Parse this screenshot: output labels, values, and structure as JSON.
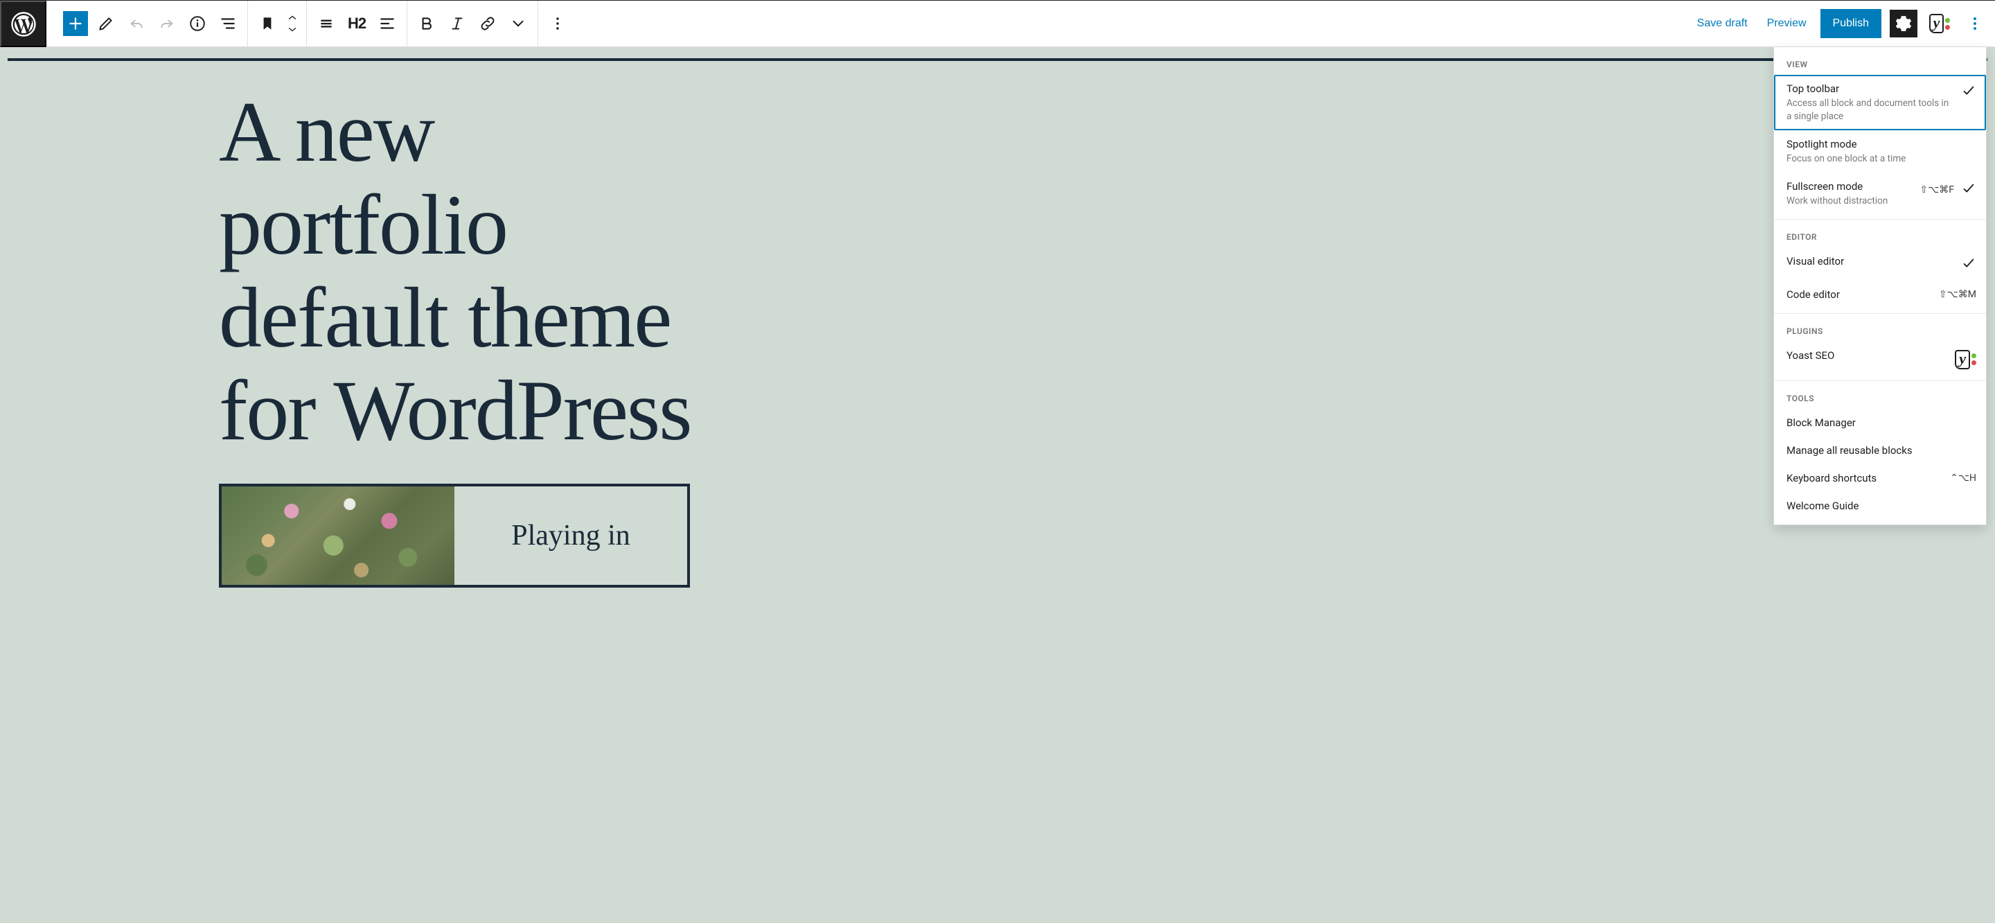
{
  "header": {
    "save_draft": "Save draft",
    "preview": "Preview",
    "publish": "Publish",
    "heading_level": "H2"
  },
  "canvas": {
    "title": "A new portfolio default theme for WordPress",
    "media_caption": "Playing in"
  },
  "options_panel": {
    "sections": [
      {
        "heading": "VIEW",
        "items": [
          {
            "title": "Top toolbar",
            "desc": "Access all block and document tools in a single place",
            "shortcut": "",
            "checked": true,
            "selected": true
          },
          {
            "title": "Spotlight mode",
            "desc": "Focus on one block at a time",
            "shortcut": "",
            "checked": false,
            "selected": false
          },
          {
            "title": "Fullscreen mode",
            "desc": "Work without distraction",
            "shortcut": "⇧⌥⌘F",
            "checked": true,
            "selected": false
          }
        ]
      },
      {
        "heading": "EDITOR",
        "items": [
          {
            "title": "Visual editor",
            "desc": "",
            "shortcut": "",
            "checked": true,
            "selected": false
          },
          {
            "title": "Code editor",
            "desc": "",
            "shortcut": "⇧⌥⌘M",
            "checked": false,
            "selected": false
          }
        ]
      },
      {
        "heading": "PLUGINS",
        "items": [
          {
            "title": "Yoast SEO",
            "desc": "",
            "shortcut": "",
            "checked": false,
            "selected": false,
            "icon": "yoast"
          }
        ]
      },
      {
        "heading": "TOOLS",
        "items": [
          {
            "title": "Block Manager",
            "desc": "",
            "shortcut": "",
            "checked": false,
            "selected": false
          },
          {
            "title": "Manage all reusable blocks",
            "desc": "",
            "shortcut": "",
            "checked": false,
            "selected": false
          },
          {
            "title": "Keyboard shortcuts",
            "desc": "",
            "shortcut": "⌃⌥H",
            "checked": false,
            "selected": false
          },
          {
            "title": "Welcome Guide",
            "desc": "",
            "shortcut": "",
            "checked": false,
            "selected": false
          }
        ]
      }
    ]
  }
}
